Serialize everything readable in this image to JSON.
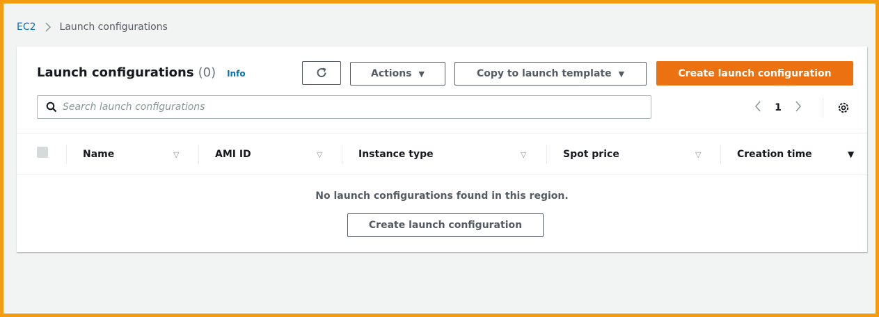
{
  "breadcrumb": {
    "root": "EC2",
    "current": "Launch configurations"
  },
  "header": {
    "title": "Launch configurations",
    "count": "(0)",
    "info": "Info",
    "actions_label": "Actions",
    "copy_label": "Copy to launch template",
    "create_label": "Create launch configuration"
  },
  "search": {
    "placeholder": "Search launch configurations"
  },
  "pager": {
    "current_page": "1"
  },
  "table": {
    "columns": [
      "Name",
      "AMI ID",
      "Instance type",
      "Spot price",
      "Creation time"
    ]
  },
  "empty_state": {
    "message": "No launch configurations found in this region.",
    "button_label": "Create launch configuration"
  },
  "colors": {
    "accent": "#ec7211",
    "link": "#0073bb",
    "frame_border": "#f39c12"
  }
}
